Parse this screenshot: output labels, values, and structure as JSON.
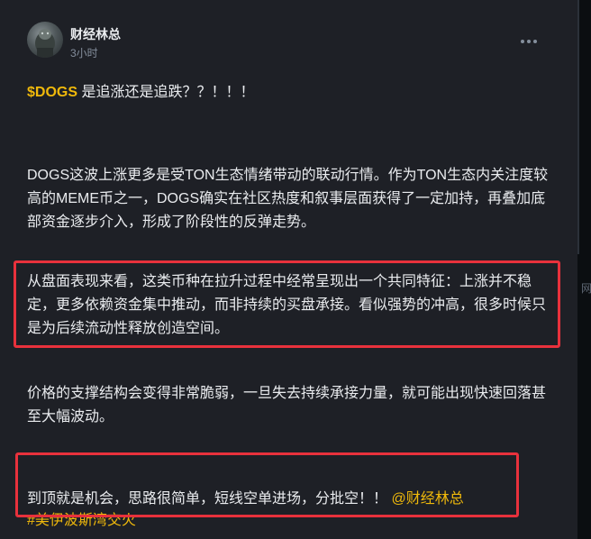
{
  "author": {
    "name": "财经林总",
    "time": "3小时"
  },
  "post": {
    "ticker": "$DOGS",
    "title_rest": " 是追涨还是追跌？？！！！",
    "paragraph1": "DOGS这波上涨更多是受TON生态情绪带动的联动行情。作为TON生态内关注度较高的MEME币之一，DOGS确实在社区热度和叙事层面获得了一定加持，再叠加底部资金逐步介入，形成了阶段性的反弹走势。",
    "paragraph2": "从盘面表现来看，这类币种在拉升过程中经常呈现出一个共同特征：上涨并不稳定，更多依赖资金集中推动，而非持续的买盘承接。看似强势的冲高，很多时候只是为后续流动性释放创造空间。",
    "paragraph3": "价格的支撑结构会变得非常脆弱，一旦失去持续承接力量，就可能出现快速回落甚至大幅波动。",
    "paragraph4": "到顶就是机会，思路很简单，短线空单进场，分批空！！",
    "mention": "@财经林总",
    "hashtag": "#美伊波斯湾交火"
  },
  "gutter": {
    "char": "网"
  },
  "icons": {
    "more": "more-horizontal-icon",
    "avatar": "avatar-image"
  },
  "colors": {
    "background": "#1e2026",
    "text": "#eaecef",
    "muted": "#848e9c",
    "accent": "#f0b90b",
    "highlight_box": "#e8313c"
  }
}
